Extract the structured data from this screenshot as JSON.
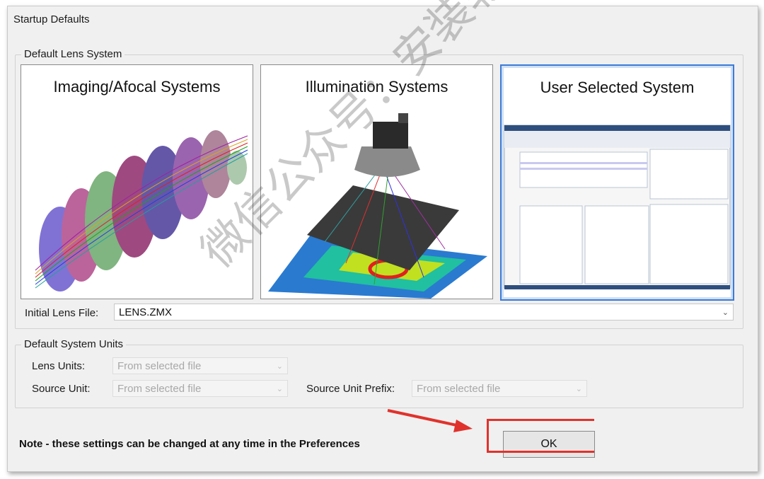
{
  "dialog": {
    "title": "Startup Defaults",
    "lens_group": {
      "label": "Default Lens System",
      "cards": [
        {
          "title": "Imaging/Afocal Systems",
          "selected": false
        },
        {
          "title": "Illumination Systems",
          "selected": false
        },
        {
          "title": "User Selected System",
          "selected": true
        }
      ],
      "initial_lens_label": "Initial Lens File:",
      "initial_lens_value": "LENS.ZMX"
    },
    "units_group": {
      "label": "Default System Units",
      "lens_units_label": "Lens Units:",
      "lens_units_value": "From selected file",
      "source_unit_label": "Source Unit:",
      "source_unit_value": "From selected file",
      "source_prefix_label": "Source Unit Prefix:",
      "source_prefix_value": "From selected file"
    },
    "note": "Note - these settings can be changed at any time in the Preferences",
    "ok_label": "OK"
  },
  "watermark": "微信公众号：安装软件指南",
  "colors": {
    "highlight": "#e0322c",
    "selection": "#3d7bd6"
  }
}
